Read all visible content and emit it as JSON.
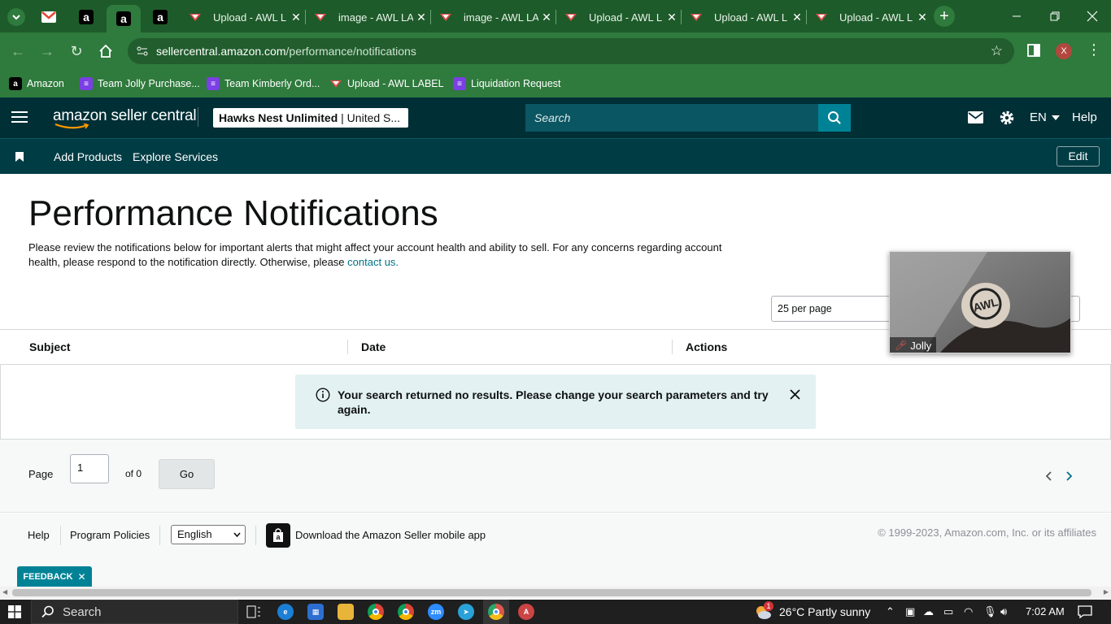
{
  "browser": {
    "tabs": [
      {
        "title": "Upload - AWL L"
      },
      {
        "title": "image - AWL LA"
      },
      {
        "title": "image - AWL LA"
      },
      {
        "title": "Upload - AWL L"
      },
      {
        "title": "Upload - AWL L"
      },
      {
        "title": "Upload - AWL L"
      }
    ],
    "url_host": "sellercentral.amazon.com",
    "url_path": "/performance/notifications",
    "profile_initial": "X",
    "bookmarks": [
      {
        "label": "Amazon"
      },
      {
        "label": "Team Jolly Purchase..."
      },
      {
        "label": "Team Kimberly Ord..."
      },
      {
        "label": "Upload - AWL LABEL"
      },
      {
        "label": "Liquidation Request"
      }
    ]
  },
  "header": {
    "logo_text": "amazon seller central",
    "store_name": "Hawks Nest Unlimited",
    "marketplace": "| United S...",
    "search_placeholder": "Search",
    "language": "EN",
    "help": "Help"
  },
  "subnav": {
    "items": [
      "Add Products",
      "Explore Services"
    ],
    "edit": "Edit"
  },
  "main": {
    "title": "Performance Notifications",
    "intro": "Please review the notifications below for important alerts that might affect your account health and ability to sell. For any concerns regarding account health, please respond to the notification directly. Otherwise, please",
    "contact_link": "contact us.",
    "per_page": "25 per page",
    "columns": [
      "Subject",
      "Date",
      "Actions"
    ],
    "alert": "Your search returned no results. Please change your search parameters and try again."
  },
  "pager": {
    "page_label": "Page",
    "page_value": "1",
    "of_label": "of 0",
    "go": "Go"
  },
  "footer": {
    "help": "Help",
    "policies": "Program Policies",
    "language": "English",
    "app": "Download the Amazon Seller mobile app",
    "copyright": "© 1999-2023, Amazon.com, Inc. or its affiliates"
  },
  "feedback": "FEEDBACK",
  "video": {
    "name": "Jolly"
  },
  "taskbar": {
    "search": "Search",
    "weather": "26°C  Partly sunny",
    "time": "7:02 AM",
    "badge": "1"
  },
  "colors": {
    "browser_frame": "#1e5b2a",
    "sc_header": "#002f36",
    "link": "#007185",
    "alert_bg": "#e3f1f2",
    "feedback": "#008296"
  }
}
